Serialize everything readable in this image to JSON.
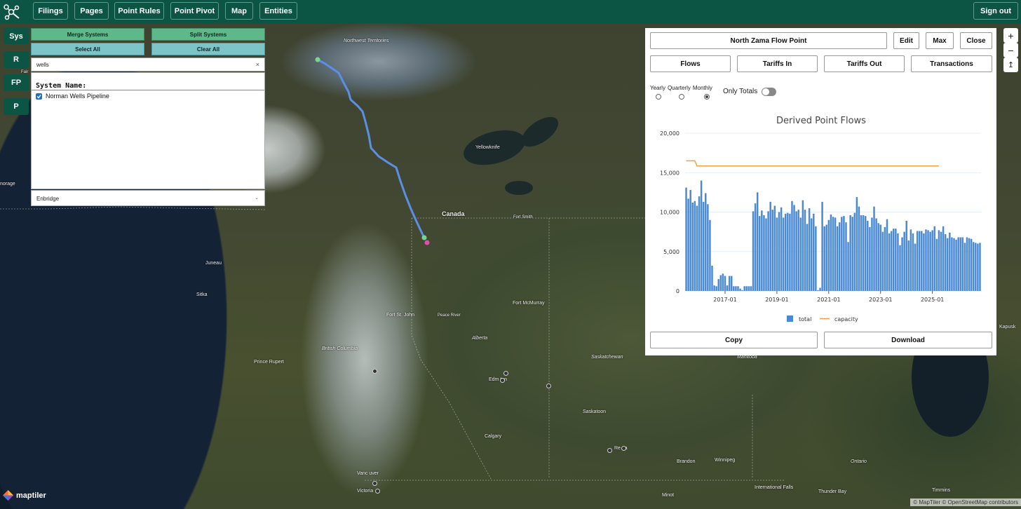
{
  "nav": {
    "items": [
      "Filings",
      "Pages",
      "Point Rules",
      "Point Pivot",
      "Map",
      "Entities"
    ],
    "sign_out": "Sign out"
  },
  "sidebar": {
    "items": [
      "Sys",
      "R",
      "FP",
      "P"
    ]
  },
  "systems": {
    "merge_label": "Merge Systems",
    "split_label": "Split Systems",
    "select_all_label": "Select All",
    "clear_all_label": "Clear All",
    "search_value": "wells",
    "clear_icon": "×",
    "list_header": "System Name:",
    "list_items": [
      "Norman Wells Pipeline"
    ],
    "operator_value": "Enbridge"
  },
  "map": {
    "labels": {
      "nwt": "Northwest Territories",
      "yellowknife": "Yellowknife",
      "canada": "Canada",
      "fort_smith": "Fort Smith",
      "fort_mcmurray": "Fort McMurray",
      "fort_st_john": "Fort St. John",
      "peace_river": "Peace River",
      "alberta": "Alberta",
      "bc": "British Columbia",
      "prince_rupert": "Prince Rupert",
      "juneau": "Juneau",
      "sitka": "Sitka",
      "saskatchewan": "Saskatchewan",
      "manitoba": "Manitoba",
      "edmonton": "Edm    ton",
      "saskatoon": "Saskatoon",
      "calgary": "Calgary",
      "regina": "Re  na",
      "brandon": "Brandon",
      "winnipeg": "Winnipeg",
      "ontario": "Ontario",
      "vancouver": "Vanc  uver",
      "victoria": "Victoria",
      "minot": "Minot",
      "international_falls": "International Falls",
      "thunder_bay": "Thunder Bay",
      "timmins": "Timmins",
      "kapuskasing": "Kapusk",
      "anchorage": "norage",
      "fair": "Fair"
    },
    "brand": "maptiler",
    "attribution": "© MapTiler © OpenStreetMap contributors",
    "controls": [
      "+",
      "−",
      "↥"
    ]
  },
  "panel": {
    "point_name": "North Zama Flow Point",
    "edit_label": "Edit",
    "max_label": "Max",
    "close_label": "Close",
    "tabs": [
      "Flows",
      "Tariffs In",
      "Tariffs Out",
      "Transactions"
    ],
    "periods": [
      "Yearly",
      "Quarterly",
      "Monthly"
    ],
    "selected_period": "Monthly",
    "only_totals_label": "Only Totals",
    "copy_label": "Copy",
    "download_label": "Download"
  },
  "chart_data": {
    "type": "bar",
    "title": "Derived Point Flows",
    "xlabel": "",
    "ylabel": "",
    "ylim": [
      0,
      20000
    ],
    "yticks": [
      "0",
      "5,000",
      "10,000",
      "15,000",
      "20,000"
    ],
    "xticks": [
      "2017-01",
      "2019-01",
      "2021-01",
      "2023-01",
      "2025-01"
    ],
    "x_start": "2015-07",
    "x_end": "2025-04",
    "legend": [
      "total",
      "capacity"
    ],
    "legend_position": "bottom",
    "colors": {
      "total": "#4a8ad4",
      "capacity": "#f5a03c"
    },
    "series": [
      {
        "name": "total",
        "values": [
          13100,
          11700,
          12800,
          11200,
          11400,
          10800,
          12000,
          14000,
          11300,
          12400,
          11000,
          9000,
          3200,
          700,
          600,
          1500,
          2000,
          2200,
          1900,
          700,
          1900,
          1900,
          600,
          600,
          600,
          300,
          100,
          600,
          600,
          600,
          600,
          10100,
          11100,
          12500,
          9500,
          10200,
          9600,
          9200,
          10100,
          11300,
          10300,
          10800,
          9300,
          10000,
          10600,
          9300,
          9800,
          9900,
          9800,
          11400,
          10900,
          10100,
          10300,
          9300,
          11500,
          10300,
          8500,
          10500,
          9200,
          9800,
          8200,
          100,
          400,
          11300,
          8200,
          8400,
          9000,
          9700,
          9400,
          9300,
          8200,
          8700,
          9400,
          9500,
          8700,
          6200,
          9600,
          9400,
          9900,
          11900,
          10700,
          9600,
          9600,
          9500,
          8900,
          8100,
          9300,
          10700,
          9200,
          8600,
          8400,
          7500,
          8100,
          9100,
          7300,
          7600,
          7900,
          7900,
          7300,
          5800,
          6800,
          7500,
          8900,
          6400,
          7800,
          7300,
          6000,
          7600,
          7600,
          7600,
          7300,
          7800,
          7700,
          7500,
          7700,
          8200,
          6600,
          7700,
          7500,
          8200,
          7200,
          6700,
          7400,
          6800,
          6700,
          6500,
          6800,
          6800,
          6800,
          6100,
          6800,
          6700,
          6600,
          6200,
          6100,
          6000,
          6100
        ],
        "count": 118
      },
      {
        "name": "capacity",
        "values": [
          16500,
          16500,
          16500,
          16500,
          16500,
          15850,
          15850,
          15850,
          15850,
          15850,
          15850,
          15850,
          15850,
          15850,
          15850,
          15850,
          15850,
          15850,
          15850,
          15850,
          15850,
          15850,
          15850,
          15850,
          15850,
          15850,
          15850,
          15850,
          15850,
          15850,
          15850,
          15850,
          15850,
          15850,
          15850,
          15850,
          15850,
          15850,
          15850,
          15850,
          15850,
          15850,
          15850,
          15850,
          15850,
          15850,
          15850,
          15850,
          15850,
          15850,
          15850,
          15850,
          15850,
          15850,
          15850,
          15850,
          15850,
          15850,
          15850,
          15850,
          15850,
          15850,
          15850,
          15850,
          15850,
          15850,
          15850,
          15850,
          15850,
          15850,
          15850,
          15850,
          15850,
          15850,
          15850,
          15850,
          15850,
          15850,
          15850,
          15850,
          15850,
          15850,
          15850,
          15850,
          15850,
          15850,
          15850,
          15850,
          15850,
          15850,
          15850,
          15850,
          15850,
          15850,
          15850,
          15850,
          15850,
          15850,
          15850,
          15850,
          15850,
          15850,
          15850,
          15850,
          15850,
          15850,
          15850,
          15850,
          15850,
          15850,
          15850,
          15850,
          15850,
          15850,
          15850,
          15850,
          15850,
          15850
        ],
        "note": ""
      }
    ]
  }
}
